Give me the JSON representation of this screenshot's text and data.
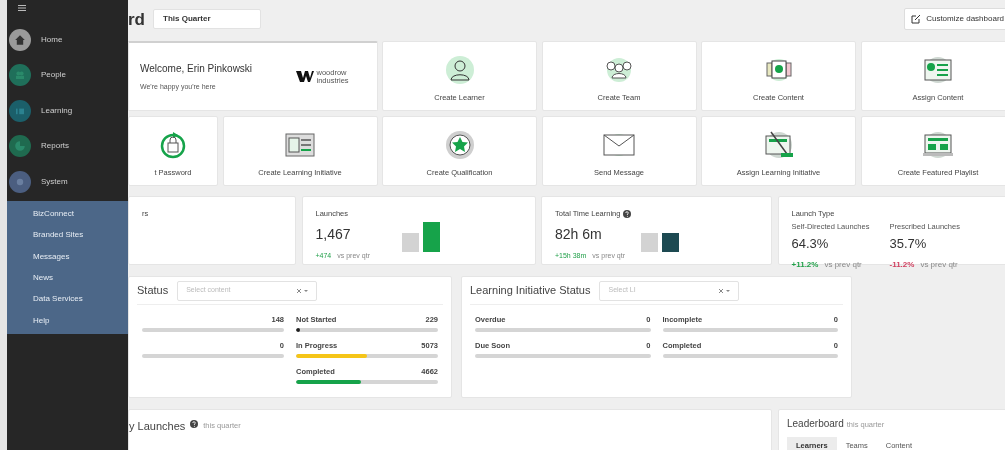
{
  "sidebar": {
    "items": [
      {
        "label": "Home"
      },
      {
        "label": "People"
      },
      {
        "label": "Learning"
      },
      {
        "label": "Reports"
      },
      {
        "label": "System",
        "expanded": true,
        "children": [
          {
            "label": "BizConnect"
          },
          {
            "label": "Branded Sites"
          },
          {
            "label": "Messages"
          },
          {
            "label": "News"
          },
          {
            "label": "Data Services"
          },
          {
            "label": "Help"
          }
        ]
      }
    ]
  },
  "header": {
    "title": "rd",
    "period": "This Quarter",
    "customize_button": "Customize dashboard"
  },
  "welcome": {
    "title": "Welcome, Erin Pinkowski",
    "subtitle": "We're happy you're here",
    "logo_text": "woodrow industries"
  },
  "tiles": [
    "Create Learner",
    "Create Team",
    "Create Content",
    "Assign Content",
    "t Password",
    "Create Learning Initiative",
    "Create Qualification",
    "Send Message",
    "Assign Learning Initiative",
    "Create Featured Playlist"
  ],
  "stats": [
    {
      "kind": "blank",
      "title": "rs"
    },
    {
      "kind": "bars",
      "title": "Launches",
      "help": false,
      "value": "1,467",
      "delta": "+474",
      "note": "vs prev qtr",
      "color": "#16a34a"
    },
    {
      "kind": "bars",
      "title": "Total Time Learning",
      "help": true,
      "value": "82h 6m",
      "delta": "+15h 38m",
      "note": "vs prev qtr",
      "color": "#1d4a52"
    },
    {
      "kind": "split",
      "title": "Launch Type",
      "parts": [
        {
          "label": "Self-Directed Launches",
          "value": "64.3%",
          "delta": "+11.2%",
          "color": "#22a04a",
          "note": "vs prev qtr"
        },
        {
          "label": "Prescribed Launches",
          "value": "35.7%",
          "delta": "-11.2%",
          "color": "#d04060",
          "note": "vs prev qtr"
        }
      ]
    }
  ],
  "content_status": {
    "title": "Status",
    "select_placeholder": "Select content",
    "left": [
      {
        "value": "148",
        "level": 0
      },
      {
        "value": "0",
        "level": 0
      }
    ],
    "right": [
      {
        "label": "Not Started",
        "value": "229",
        "level": 0.03,
        "color": "#1f1f1f"
      },
      {
        "label": "In Progress",
        "value": "5073",
        "level": 0.5,
        "color": "#f5c518"
      },
      {
        "label": "Completed",
        "value": "4662",
        "level": 0.46,
        "color": "#16a34a"
      }
    ]
  },
  "li_status": {
    "title": "Learning Initiative Status",
    "select_placeholder": "Select LI",
    "left": [
      {
        "label": "Overdue",
        "value": "0",
        "level": 0
      },
      {
        "label": "Due Soon",
        "value": "0",
        "level": 0
      }
    ],
    "right": [
      {
        "label": "Incomplete",
        "value": "0",
        "level": 0
      },
      {
        "label": "Completed",
        "value": "0",
        "level": 0
      }
    ]
  },
  "launches_panel": {
    "title": "y Launches",
    "note": "this quarter"
  },
  "leaderboard": {
    "title": "Leaderboard",
    "note": "this quarter",
    "tabs": [
      {
        "label": "Learners",
        "selected": true
      },
      {
        "label": "Teams",
        "selected": false
      },
      {
        "label": "Content",
        "selected": false
      }
    ]
  }
}
